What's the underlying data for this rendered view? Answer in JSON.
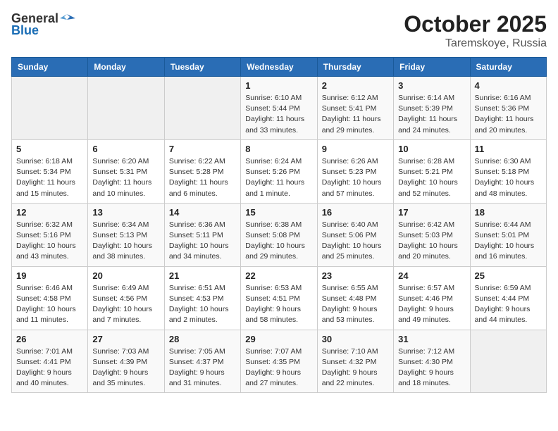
{
  "header": {
    "logo_general": "General",
    "logo_blue": "Blue",
    "title": "October 2025",
    "location": "Taremskoye, Russia"
  },
  "calendar": {
    "days_of_week": [
      "Sunday",
      "Monday",
      "Tuesday",
      "Wednesday",
      "Thursday",
      "Friday",
      "Saturday"
    ],
    "weeks": [
      [
        {
          "day": "",
          "info": ""
        },
        {
          "day": "",
          "info": ""
        },
        {
          "day": "",
          "info": ""
        },
        {
          "day": "1",
          "info": "Sunrise: 6:10 AM\nSunset: 5:44 PM\nDaylight: 11 hours\nand 33 minutes."
        },
        {
          "day": "2",
          "info": "Sunrise: 6:12 AM\nSunset: 5:41 PM\nDaylight: 11 hours\nand 29 minutes."
        },
        {
          "day": "3",
          "info": "Sunrise: 6:14 AM\nSunset: 5:39 PM\nDaylight: 11 hours\nand 24 minutes."
        },
        {
          "day": "4",
          "info": "Sunrise: 6:16 AM\nSunset: 5:36 PM\nDaylight: 11 hours\nand 20 minutes."
        }
      ],
      [
        {
          "day": "5",
          "info": "Sunrise: 6:18 AM\nSunset: 5:34 PM\nDaylight: 11 hours\nand 15 minutes."
        },
        {
          "day": "6",
          "info": "Sunrise: 6:20 AM\nSunset: 5:31 PM\nDaylight: 11 hours\nand 10 minutes."
        },
        {
          "day": "7",
          "info": "Sunrise: 6:22 AM\nSunset: 5:28 PM\nDaylight: 11 hours\nand 6 minutes."
        },
        {
          "day": "8",
          "info": "Sunrise: 6:24 AM\nSunset: 5:26 PM\nDaylight: 11 hours\nand 1 minute."
        },
        {
          "day": "9",
          "info": "Sunrise: 6:26 AM\nSunset: 5:23 PM\nDaylight: 10 hours\nand 57 minutes."
        },
        {
          "day": "10",
          "info": "Sunrise: 6:28 AM\nSunset: 5:21 PM\nDaylight: 10 hours\nand 52 minutes."
        },
        {
          "day": "11",
          "info": "Sunrise: 6:30 AM\nSunset: 5:18 PM\nDaylight: 10 hours\nand 48 minutes."
        }
      ],
      [
        {
          "day": "12",
          "info": "Sunrise: 6:32 AM\nSunset: 5:16 PM\nDaylight: 10 hours\nand 43 minutes."
        },
        {
          "day": "13",
          "info": "Sunrise: 6:34 AM\nSunset: 5:13 PM\nDaylight: 10 hours\nand 38 minutes."
        },
        {
          "day": "14",
          "info": "Sunrise: 6:36 AM\nSunset: 5:11 PM\nDaylight: 10 hours\nand 34 minutes."
        },
        {
          "day": "15",
          "info": "Sunrise: 6:38 AM\nSunset: 5:08 PM\nDaylight: 10 hours\nand 29 minutes."
        },
        {
          "day": "16",
          "info": "Sunrise: 6:40 AM\nSunset: 5:06 PM\nDaylight: 10 hours\nand 25 minutes."
        },
        {
          "day": "17",
          "info": "Sunrise: 6:42 AM\nSunset: 5:03 PM\nDaylight: 10 hours\nand 20 minutes."
        },
        {
          "day": "18",
          "info": "Sunrise: 6:44 AM\nSunset: 5:01 PM\nDaylight: 10 hours\nand 16 minutes."
        }
      ],
      [
        {
          "day": "19",
          "info": "Sunrise: 6:46 AM\nSunset: 4:58 PM\nDaylight: 10 hours\nand 11 minutes."
        },
        {
          "day": "20",
          "info": "Sunrise: 6:49 AM\nSunset: 4:56 PM\nDaylight: 10 hours\nand 7 minutes."
        },
        {
          "day": "21",
          "info": "Sunrise: 6:51 AM\nSunset: 4:53 PM\nDaylight: 10 hours\nand 2 minutes."
        },
        {
          "day": "22",
          "info": "Sunrise: 6:53 AM\nSunset: 4:51 PM\nDaylight: 9 hours\nand 58 minutes."
        },
        {
          "day": "23",
          "info": "Sunrise: 6:55 AM\nSunset: 4:48 PM\nDaylight: 9 hours\nand 53 minutes."
        },
        {
          "day": "24",
          "info": "Sunrise: 6:57 AM\nSunset: 4:46 PM\nDaylight: 9 hours\nand 49 minutes."
        },
        {
          "day": "25",
          "info": "Sunrise: 6:59 AM\nSunset: 4:44 PM\nDaylight: 9 hours\nand 44 minutes."
        }
      ],
      [
        {
          "day": "26",
          "info": "Sunrise: 7:01 AM\nSunset: 4:41 PM\nDaylight: 9 hours\nand 40 minutes."
        },
        {
          "day": "27",
          "info": "Sunrise: 7:03 AM\nSunset: 4:39 PM\nDaylight: 9 hours\nand 35 minutes."
        },
        {
          "day": "28",
          "info": "Sunrise: 7:05 AM\nSunset: 4:37 PM\nDaylight: 9 hours\nand 31 minutes."
        },
        {
          "day": "29",
          "info": "Sunrise: 7:07 AM\nSunset: 4:35 PM\nDaylight: 9 hours\nand 27 minutes."
        },
        {
          "day": "30",
          "info": "Sunrise: 7:10 AM\nSunset: 4:32 PM\nDaylight: 9 hours\nand 22 minutes."
        },
        {
          "day": "31",
          "info": "Sunrise: 7:12 AM\nSunset: 4:30 PM\nDaylight: 9 hours\nand 18 minutes."
        },
        {
          "day": "",
          "info": ""
        }
      ]
    ]
  }
}
